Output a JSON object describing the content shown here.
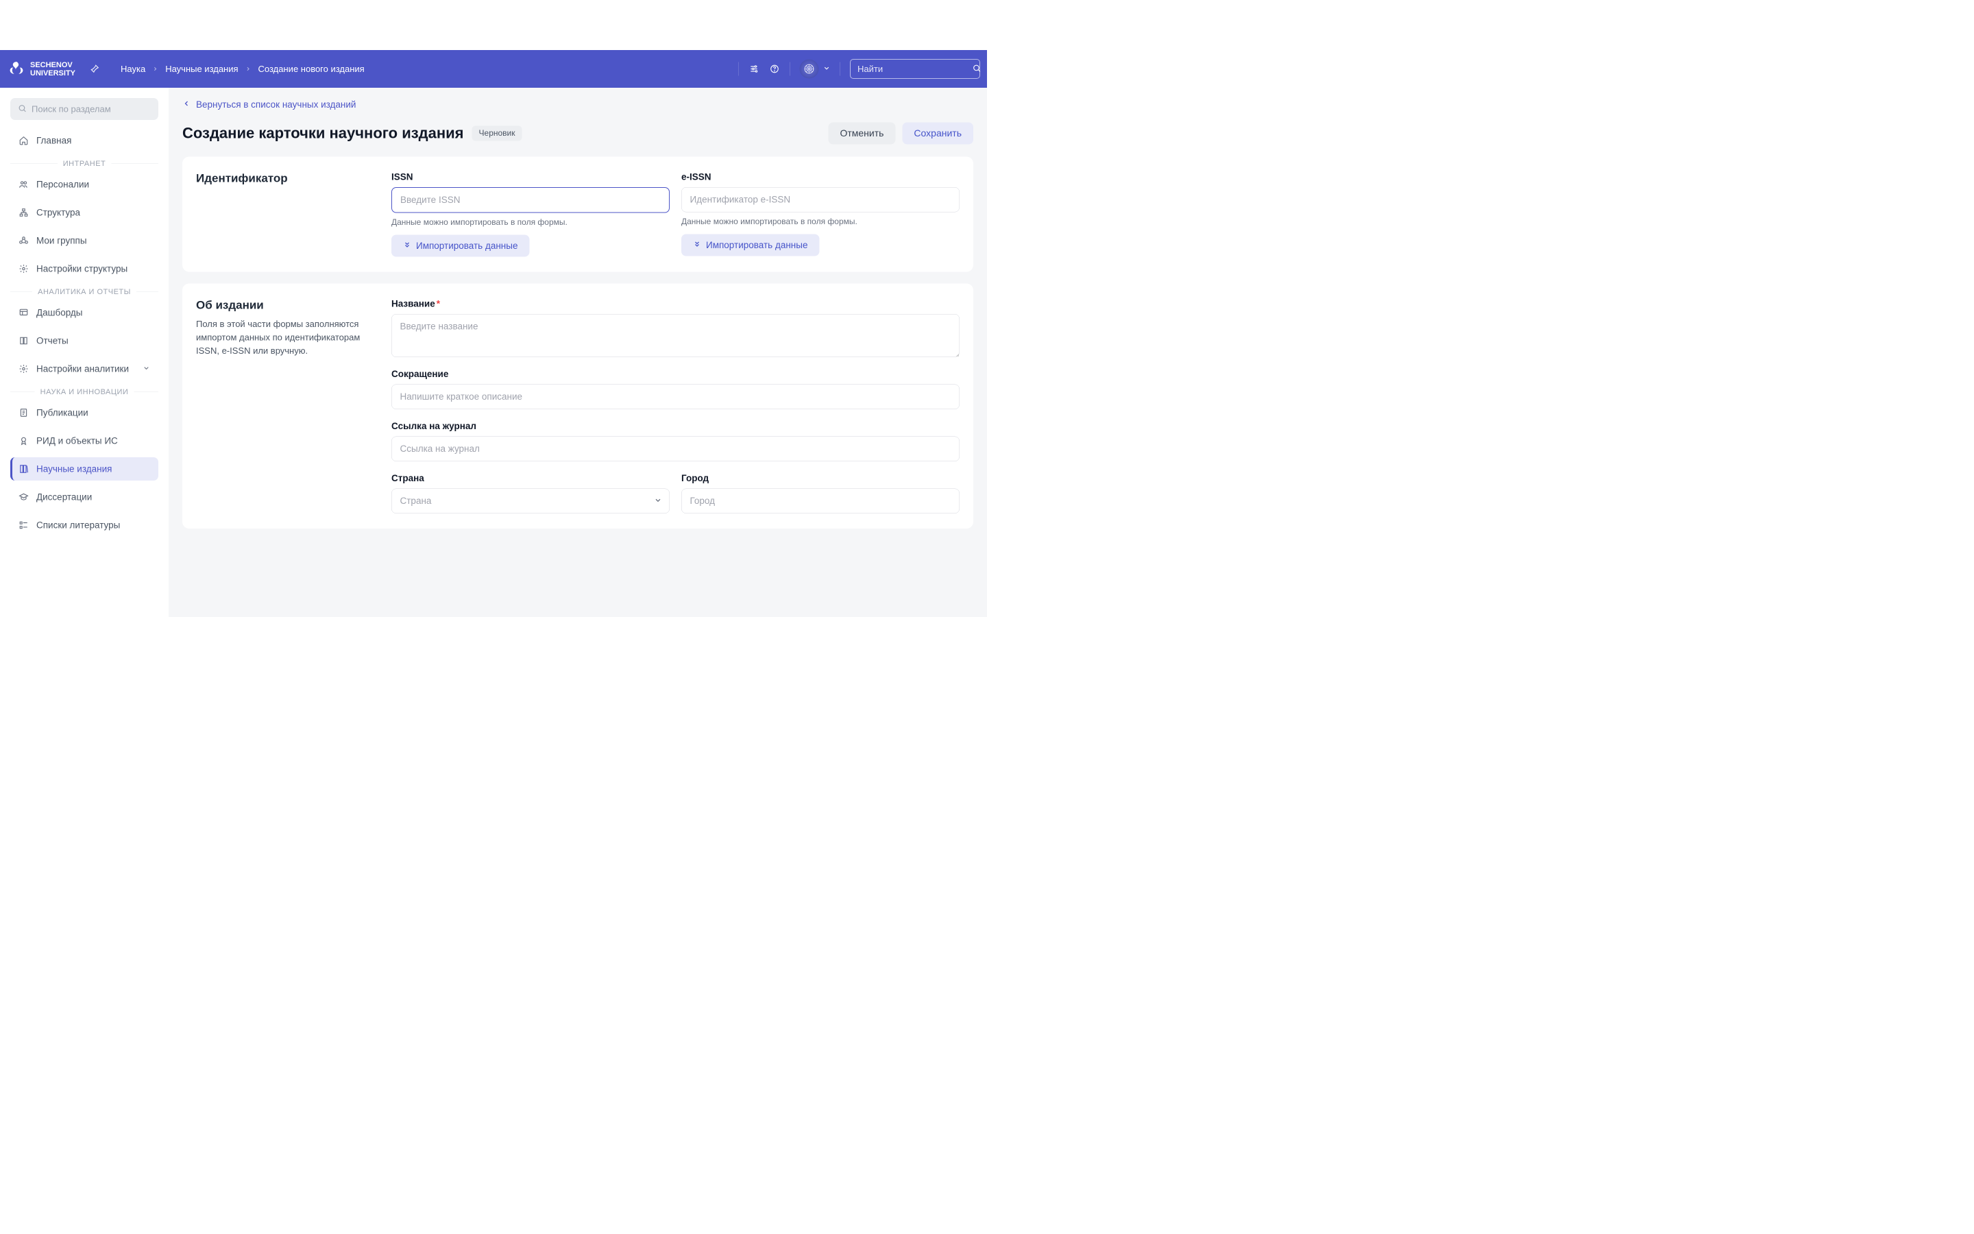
{
  "brand": {
    "line1": "SECHENOV",
    "line2": "UNIVERSITY"
  },
  "breadcrumb": {
    "a": "Наука",
    "b": "Научные издания",
    "c": "Создание нового издания"
  },
  "header_search": {
    "placeholder": "Найти"
  },
  "sidebar": {
    "search_placeholder": "Поиск по разделам",
    "home": "Главная",
    "sec_intranet": "ИНТРАНЕТ",
    "intranet": [
      "Персоналии",
      "Структура",
      "Мои группы",
      "Настройки структуры"
    ],
    "sec_analytics": "АНАЛИТИКА И ОТЧЕТЫ",
    "analytics": [
      "Дашборды",
      "Отчеты",
      "Настройки аналитики"
    ],
    "sec_science": "НАУКА И ИННОВАЦИИ",
    "science": [
      "Публикации",
      "РИД и объекты ИС",
      "Научные издания",
      "Диссертации",
      "Списки литературы"
    ]
  },
  "backlink": "Вернуться в список научных изданий",
  "page_title": "Создание карточки научного издания",
  "badge": "Черновик",
  "btn_cancel": "Отменить",
  "btn_save": "Сохранить",
  "section_id": {
    "title": "Идентификатор",
    "issn_label": "ISSN",
    "issn_placeholder": "Введите ISSN",
    "issn_hint": "Данные можно импортировать в поля формы.",
    "eissn_label": "e-ISSN",
    "eissn_placeholder": "Идентификатор e-ISSN",
    "eissn_hint": "Данные можно импортировать в поля формы.",
    "import_btn": "Импортировать данные"
  },
  "section_about": {
    "title": "Об издании",
    "desc": "Поля в этой части формы заполняются импортом данных по идентификаторам ISSN, e-ISSN или вручную.",
    "name_label": "Название",
    "name_placeholder": "Введите название",
    "abbr_label": "Сокращение",
    "abbr_placeholder": "Напишите краткое описание",
    "link_label": "Ссылка на журнал",
    "link_placeholder": "Ссылка на журнал",
    "country_label": "Страна",
    "country_placeholder": "Страна",
    "city_label": "Город",
    "city_placeholder": "Город"
  }
}
